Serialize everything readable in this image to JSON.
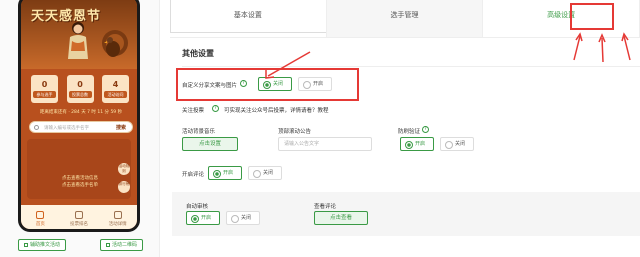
{
  "phone": {
    "banner_title": "天天感恩节",
    "stats": [
      {
        "value": "0",
        "label": "参与选手"
      },
      {
        "value": "0",
        "label": "投票总数"
      },
      {
        "value": "4",
        "label": "活动访问"
      }
    ],
    "timer": "距离结束还有 · 284 天 7 时 11 分 59 秒",
    "search_placeholder": "请输入编号或选手名字",
    "search_button": "搜索",
    "content_text": "点击查看活动信息\n点击查看选手名单",
    "side_buttons": [
      "活动规则",
      "排行榜"
    ],
    "tabs": [
      {
        "label": "首页",
        "active": true
      },
      {
        "label": "投票排名",
        "active": false
      },
      {
        "label": "活动详情",
        "active": false
      }
    ],
    "bottom_buttons": [
      "辅助推文活动",
      "活动二维码"
    ]
  },
  "top_tabs": [
    {
      "label": "基本设置",
      "active": false
    },
    {
      "label": "选手管理",
      "active": false
    },
    {
      "label": "高级设置",
      "active": true
    }
  ],
  "section_title": "其他设置",
  "share": {
    "label": "自定义分享文案与图片",
    "opt_off": "关闭",
    "opt_on": "开启"
  },
  "follow": {
    "label": "关注投票",
    "hint": "可实现关注公众号后投票，详情请看？教程"
  },
  "music": {
    "label": "活动背景音乐",
    "button": "点击设置"
  },
  "notice": {
    "label": "顶部滚动公告",
    "placeholder": "请输入公告文字"
  },
  "anti_brush": {
    "label": "防刷验证",
    "opt_on": "开启",
    "opt_off": "关闭"
  },
  "comment": {
    "label": "开启评论",
    "opt_on": "开启",
    "opt_off": "关闭"
  },
  "auto_audit": {
    "label": "自动审核",
    "opt_on": "开启",
    "opt_off": "关闭"
  },
  "view_comments": {
    "label": "查看评论",
    "button": "点击查看"
  },
  "colors": {
    "accent": "#3a9a45",
    "highlight": "#e53935",
    "phone_bg": "#b8501e"
  }
}
